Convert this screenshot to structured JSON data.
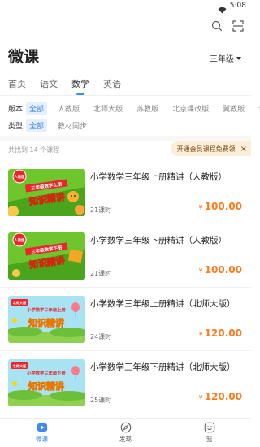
{
  "status": {
    "time": "5:08"
  },
  "header": {
    "title": "微课",
    "grade": "三年级"
  },
  "tabs": [
    {
      "label": "首页",
      "active": false
    },
    {
      "label": "语文",
      "active": false
    },
    {
      "label": "数学",
      "active": true
    },
    {
      "label": "英语",
      "active": false
    }
  ],
  "filters": {
    "version": {
      "label": "版本",
      "options": [
        "全部",
        "人教版",
        "北师大版",
        "苏教版",
        "北京课改版",
        "冀教版",
        "青"
      ]
    },
    "type": {
      "label": "类型",
      "options": [
        "全部",
        "教材同步"
      ]
    }
  },
  "list_info": {
    "count_text": "共找到 14 个课程",
    "promo_text": "开通会员课程免费领",
    "promo_close": "×"
  },
  "courses": [
    {
      "title": "小学数学三年级上册精讲（人教版）",
      "lessons": "21课时",
      "currency": "¥",
      "price": "100.00",
      "thumb_badge": "人教版",
      "thumb_banner": "三年级数学上册",
      "thumb_main": "知识精讲"
    },
    {
      "title": "小学数学三年级下册精讲（人教版）",
      "lessons": "21课时",
      "currency": "¥",
      "price": "100.00",
      "thumb_badge": "人教版",
      "thumb_banner": "三年级数学下册",
      "thumb_main": "知识精讲"
    },
    {
      "title": "小学数学三年级上册精讲（北师大版）",
      "lessons": "24课时",
      "currency": "¥",
      "price": "120.00",
      "thumb_badge": "北师大版",
      "thumb_banner": "小学数学三年级上册",
      "thumb_main": "知识精讲"
    },
    {
      "title": "小学数学三年级下册精讲（北师大版）",
      "lessons": "25课时",
      "currency": "¥",
      "price": "120.00",
      "thumb_badge": "北师大版",
      "thumb_banner": "小学数学三年级下册",
      "thumb_main": "知识精讲"
    }
  ],
  "nav": [
    {
      "label": "微课",
      "icon": "video-icon",
      "active": true
    },
    {
      "label": "发现",
      "icon": "compass-icon",
      "active": false
    },
    {
      "label": "我",
      "icon": "smiley-icon",
      "active": false
    }
  ],
  "colors": {
    "accent": "#3d8bef",
    "price": "#ff7a1a",
    "promo_bg": "#fbeed9"
  }
}
